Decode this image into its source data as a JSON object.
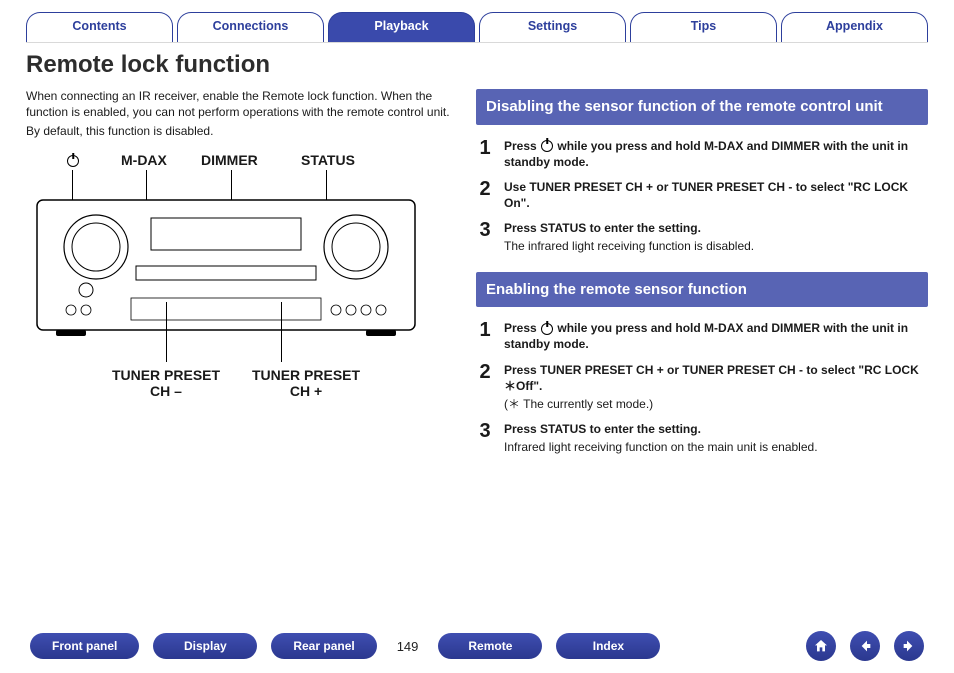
{
  "tabs": {
    "items": [
      {
        "label": "Contents",
        "active": false
      },
      {
        "label": "Connections",
        "active": false
      },
      {
        "label": "Playback",
        "active": true
      },
      {
        "label": "Settings",
        "active": false
      },
      {
        "label": "Tips",
        "active": false
      },
      {
        "label": "Appendix",
        "active": false
      }
    ]
  },
  "page_title": "Remote lock function",
  "intro": {
    "p1": "When connecting an IR receiver, enable the Remote lock function. When the function is enabled, you can not perform operations with the remote control unit.",
    "p2": "By default, this function is disabled."
  },
  "device_labels": {
    "power": "⏻",
    "mdax": "M-DAX",
    "dimmer": "DIMMER",
    "status": "STATUS",
    "preset_minus_l1": "TUNER PRESET",
    "preset_minus_l2": "CH –",
    "preset_plus_l1": "TUNER PRESET",
    "preset_plus_l2": "CH +"
  },
  "section_a": {
    "header": "Disabling the sensor function of the remote control unit",
    "steps": [
      {
        "n": "1",
        "bold_pre": "Press ",
        "bold_post": " while you press and hold M-DAX and DIMMER with the unit in standby mode.",
        "sub": ""
      },
      {
        "n": "2",
        "bold": "Use TUNER PRESET CH + or TUNER PRESET CH - to select \"RC LOCK On\".",
        "sub": ""
      },
      {
        "n": "3",
        "bold": "Press STATUS to enter the setting.",
        "sub": "The infrared light receiving function is disabled."
      }
    ]
  },
  "section_b": {
    "header": "Enabling the remote sensor function",
    "steps": [
      {
        "n": "1",
        "bold_pre": "Press ",
        "bold_post": " while you press and hold M-DAX and DIMMER with the unit in standby mode.",
        "sub": ""
      },
      {
        "n": "2",
        "bold": "Press TUNER PRESET CH + or TUNER PRESET CH - to select \"RC LOCK ＊Off\".",
        "sub": "(＊ The currently set mode.)"
      },
      {
        "n": "3",
        "bold": "Press STATUS to enter the setting.",
        "sub": "Infrared light receiving function on the main unit is enabled."
      }
    ]
  },
  "bottom": {
    "pills": [
      "Front panel",
      "Display",
      "Rear panel"
    ],
    "page": "149",
    "pills2": [
      "Remote",
      "Index"
    ]
  }
}
